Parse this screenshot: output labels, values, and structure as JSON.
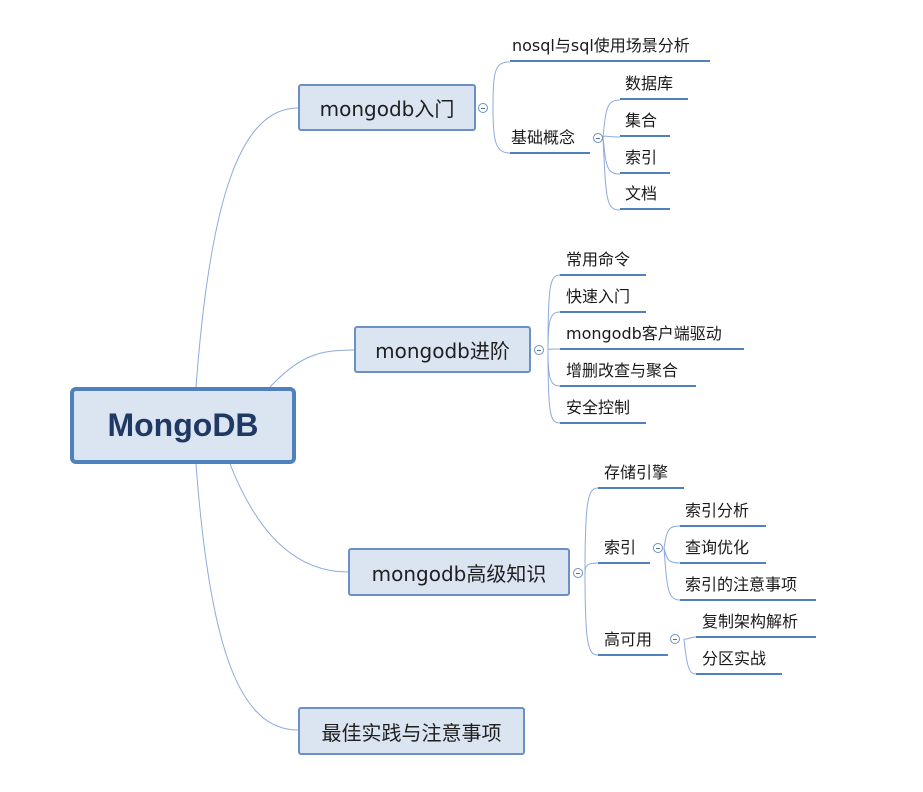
{
  "root": "MongoDB",
  "branches": {
    "intro": {
      "label": "mongodb入门",
      "items": [
        "nosql与sql使用场景分析",
        "基础概念"
      ],
      "concepts": [
        "数据库",
        "集合",
        "索引",
        "文档"
      ]
    },
    "advanced": {
      "label": "mongodb进阶",
      "items": [
        "常用命令",
        "快速入门",
        "mongodb客户端驱动",
        "增删改查与聚合",
        "安全控制"
      ]
    },
    "expert": {
      "label": "mongodb高级知识",
      "items": [
        "存储引擎",
        "索引",
        "高可用"
      ],
      "index_items": [
        "索引分析",
        "查询优化",
        "索引的注意事项"
      ],
      "ha_items": [
        "复制架构解析",
        "分区实战"
      ]
    },
    "best": {
      "label": "最佳实践与注意事项"
    }
  },
  "colors": {
    "root_fill": "#dbe5f1",
    "root_border": "#4f81bd",
    "line": "#4f81bd",
    "edge": "#8eaadb"
  }
}
